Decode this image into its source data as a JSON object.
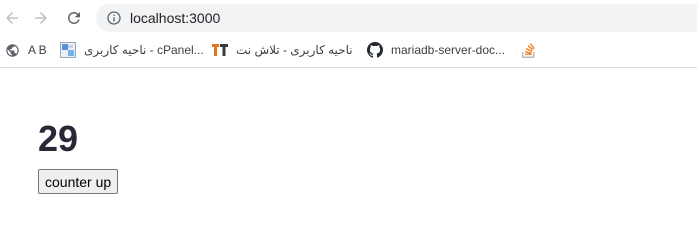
{
  "browser": {
    "address_bar": {
      "url": "localhost:3000"
    },
    "bookmarks": [
      {
        "label": "A B",
        "icon": "globe-icon"
      },
      {
        "label": "ناحیه کاربری - cPanel...",
        "icon": "cpanel-icon"
      },
      {
        "label": "ناحیه کاربری - تلاش نت",
        "icon": "tt-icon"
      },
      {
        "label": "mariadb-server-doc...",
        "icon": "github-icon"
      },
      {
        "label": "",
        "icon": "stackoverflow-icon"
      }
    ]
  },
  "page": {
    "count": "29",
    "button_label": "counter up"
  },
  "colors": {
    "count_text": "#282936",
    "omnibox_bg": "#f1f3f4"
  }
}
